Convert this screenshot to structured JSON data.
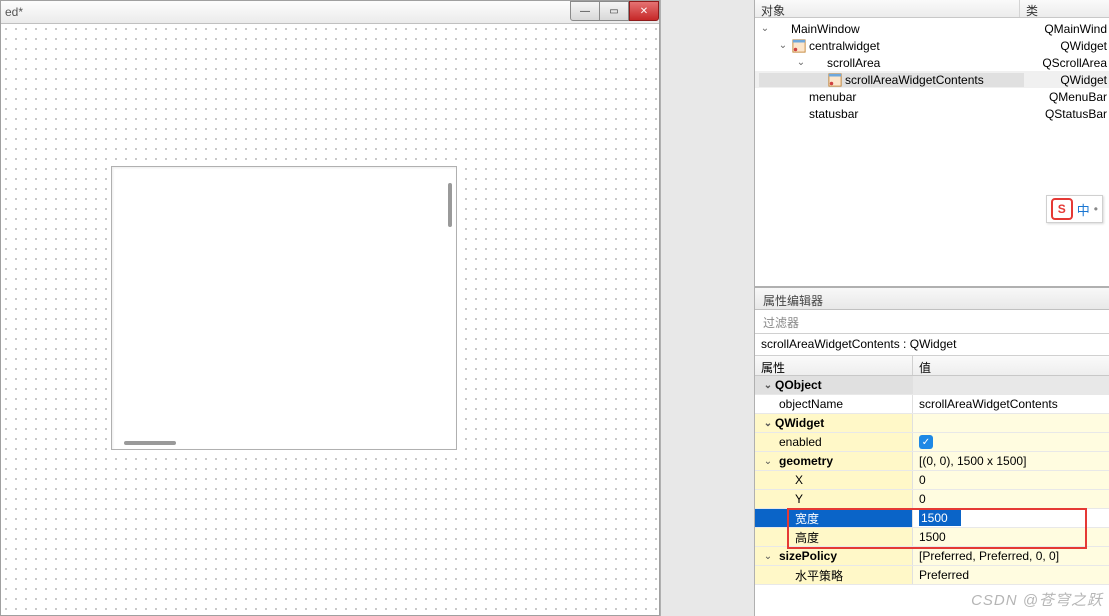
{
  "window": {
    "title": "ed*"
  },
  "tree": {
    "header_object": "对象",
    "header_class": "类",
    "rows": [
      {
        "name": "MainWindow",
        "cls": "QMainWind",
        "depth": 0,
        "exp": true,
        "ico": "none"
      },
      {
        "name": "centralwidget",
        "cls": "QWidget",
        "depth": 1,
        "exp": true,
        "ico": "widget"
      },
      {
        "name": "scrollArea",
        "cls": "QScrollArea",
        "depth": 2,
        "exp": true,
        "ico": "none"
      },
      {
        "name": "scrollAreaWidgetContents",
        "cls": "QWidget",
        "depth": 3,
        "exp": false,
        "ico": "widget",
        "selected": true
      },
      {
        "name": "menubar",
        "cls": "QMenuBar",
        "depth": 1,
        "exp": false,
        "ico": "none"
      },
      {
        "name": "statusbar",
        "cls": "QStatusBar",
        "depth": 1,
        "exp": false,
        "ico": "none"
      }
    ]
  },
  "badge": {
    "letter": "S",
    "text": "中"
  },
  "props": {
    "panel_title": "属性编辑器",
    "filter_placeholder": "过滤器",
    "object_line": "scrollAreaWidgetContents : QWidget",
    "header_name": "属性",
    "header_value": "值",
    "groups": {
      "qobject": "QObject",
      "qwidget": "QWidget"
    },
    "objectName": {
      "label": "objectName",
      "value": "scrollAreaWidgetContents"
    },
    "enabled": {
      "label": "enabled"
    },
    "geometry": {
      "label": "geometry",
      "value": "[(0, 0), 1500 x 1500]"
    },
    "x": {
      "label": "X",
      "value": "0"
    },
    "y": {
      "label": "Y",
      "value": "0"
    },
    "width": {
      "label": "宽度",
      "value": "1500"
    },
    "height": {
      "label": "高度",
      "value": "1500"
    },
    "sizePolicy": {
      "label": "sizePolicy",
      "value": "[Preferred, Preferred, 0, 0]"
    },
    "hpolicy": {
      "label": "水平策略",
      "value": "Preferred"
    }
  },
  "watermark": "CSDN @苍穹之跃"
}
